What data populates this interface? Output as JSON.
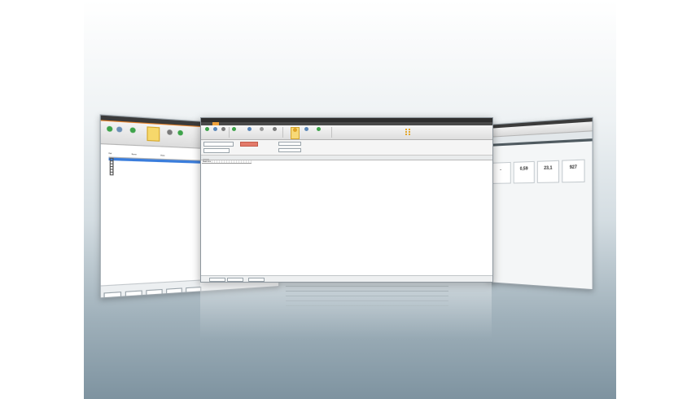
{
  "left_window": {
    "table_headers": [
      "Ref",
      "Name",
      "Value"
    ],
    "rows": [
      "",
      "",
      "",
      "",
      "",
      ""
    ]
  },
  "main_window": {
    "title": "",
    "menu": [
      "",
      "",
      "",
      "",
      "",
      "",
      "",
      "",
      "",
      ""
    ],
    "ribbon_buttons": [
      "",
      "",
      "",
      "",
      "",
      "",
      "",
      "",
      "",
      "",
      "",
      ""
    ],
    "controls": {
      "btn1": "",
      "btn2": "",
      "btn3": "",
      "field1_label": "",
      "field1_value": "",
      "field2_label": "",
      "field2_value": "",
      "check1": "",
      "check2": ""
    },
    "tabs": [
      "",
      "",
      "",
      "",
      ""
    ],
    "grid": {
      "headers": [
        "Real time",
        "",
        "",
        "",
        "",
        "",
        "",
        "",
        "",
        "",
        "",
        "",
        "",
        "",
        "",
        "",
        ""
      ],
      "rows": []
    },
    "footer_buttons": [
      "",
      "",
      ""
    ]
  },
  "right_window": {
    "tiles": [
      {
        "value": "-",
        "label": ""
      },
      {
        "value": "0,59",
        "label": ""
      },
      {
        "value": "23,1",
        "label": ""
      },
      {
        "value": "927",
        "label": ""
      }
    ]
  },
  "colors": {
    "accent": "#f0a23c",
    "selection": "#3a7ddc",
    "highlight": "#f7d977",
    "green_icon": "#3ea34a"
  }
}
